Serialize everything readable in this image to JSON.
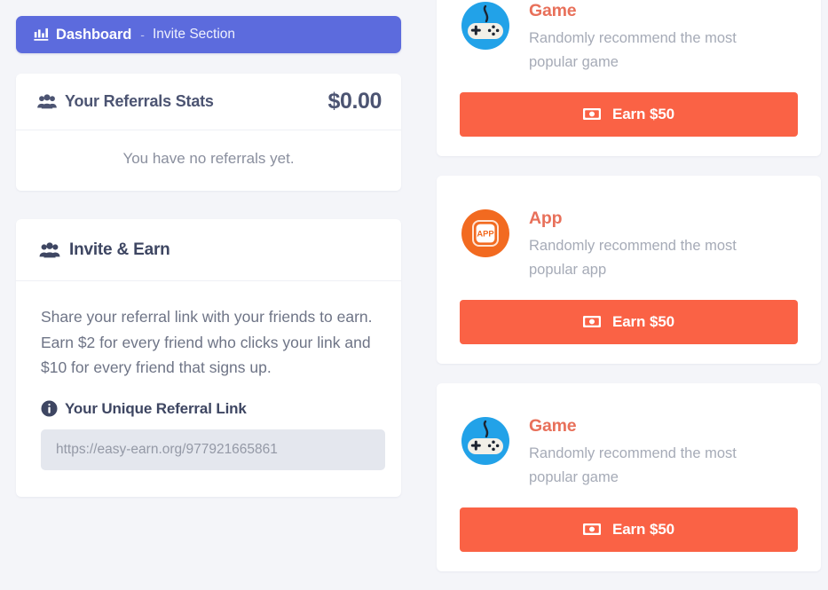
{
  "theme": {
    "page_bg": "#f4f5f9",
    "breadcrumb_bg": "#5c6bdd",
    "accent_orange": "#fa6245",
    "title_orange": "#e8705a",
    "game_icon_blue": "#22a2e8",
    "app_icon_orange": "#f26a20",
    "heading_slate": "#4c5472",
    "muted_text": "#a6abb7",
    "input_bg": "#e4e7ee"
  },
  "breadcrumb": {
    "icon": "chart-bar-icon",
    "current": "Dashboard",
    "separator": "-",
    "parent": "Invite Section"
  },
  "referrals_stats": {
    "icon": "users-icon",
    "title": "Your Referrals Stats",
    "amount": "$0.00",
    "empty_message": "You have no referrals yet."
  },
  "invite_earn": {
    "icon": "users-icon",
    "title": "Invite & Earn",
    "description": "Share your referral link with your friends to earn. Earn $2 for every friend who clicks your link and $10 for every friend that signs up.",
    "link_label_icon": "info-circle-icon",
    "link_label": "Your Unique Referral Link",
    "link_value": "https://easy-earn.org/977921665861",
    "link_placeholder": "https://easy-earn.org/977921665861"
  },
  "offers": [
    {
      "icon": "gamepad-icon",
      "title": "Game",
      "description": "Randomly recommend the most popular game",
      "button_icon": "money-bill-icon",
      "button_label": "Earn $50"
    },
    {
      "icon": "app-icon",
      "icon_text": "APP",
      "title": "App",
      "description": "Randomly recommend the most popular app",
      "button_icon": "money-bill-icon",
      "button_label": "Earn $50"
    },
    {
      "icon": "gamepad-icon",
      "title": "Game",
      "description": "Randomly recommend the most popular game",
      "button_icon": "money-bill-icon",
      "button_label": "Earn $50"
    }
  ]
}
